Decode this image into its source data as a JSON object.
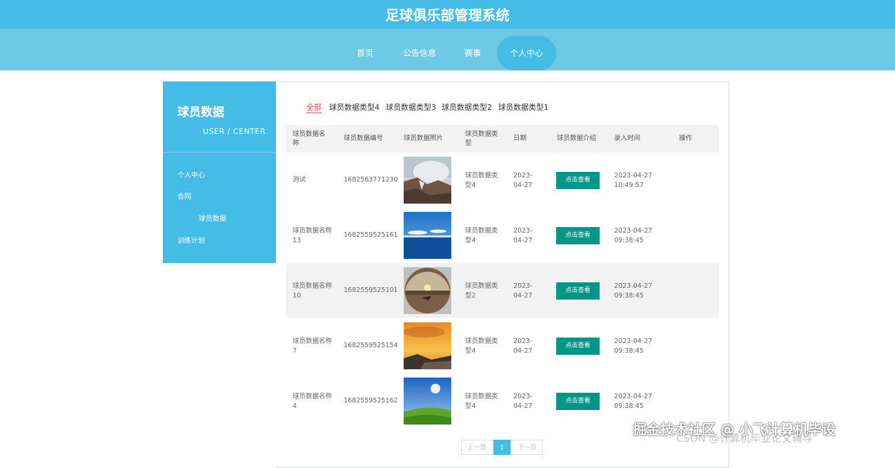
{
  "header": {
    "title": "足球俱乐部管理系统"
  },
  "nav": {
    "items": [
      {
        "label": "首页",
        "active": false
      },
      {
        "label": "公告信息",
        "active": false
      },
      {
        "label": "赛事",
        "active": false
      },
      {
        "label": "个人中心",
        "active": true
      }
    ]
  },
  "sidebar": {
    "title": "球员数据",
    "subtitle": "USER / CENTER",
    "items": [
      {
        "label": "个人中心"
      },
      {
        "label": "合同"
      },
      {
        "label": "球员数据"
      },
      {
        "label": "训练计划"
      }
    ]
  },
  "tabs": [
    {
      "label": "全部",
      "active": true
    },
    {
      "label": "球员数据类型4"
    },
    {
      "label": "球员数据类型3"
    },
    {
      "label": "球员数据类型2"
    },
    {
      "label": "球员数据类型1"
    }
  ],
  "table": {
    "headers": [
      "球员数据名称",
      "球员数据编号",
      "球员数据照片",
      "球员数据类型",
      "日期",
      "球员数据介绍",
      "录入时间",
      "操作"
    ],
    "rows": [
      {
        "name": "测试",
        "code": "1682563771230",
        "photo": "sea-rocks-photo",
        "type": "球员数据类型4",
        "date": "2023-04-27",
        "intro_button": "点击查看",
        "created": "2023-04-27 10:49:57"
      },
      {
        "name": "球员数据名称13",
        "code": "1682559525161",
        "photo": "ocean-sky-photo",
        "type": "球员数据类型4",
        "date": "2023-04-27",
        "intro_button": "点击查看",
        "created": "2023-04-27 09:38:45"
      },
      {
        "name": "球员数据名称10",
        "code": "1682559525101",
        "photo": "sunset-globe-photo",
        "type": "球员数据类型2",
        "date": "2023-04-27",
        "intro_button": "点击查看",
        "created": "2023-04-27 09:38:45"
      },
      {
        "name": "球员数据名称7",
        "code": "1682559525154",
        "photo": "golden-sunset-photo",
        "type": "球员数据类型4",
        "date": "2023-04-27",
        "intro_button": "点击查看",
        "created": "2023-04-27 09:38:45"
      },
      {
        "name": "球员数据名称4",
        "code": "1682559525162",
        "photo": "green-field-photo",
        "type": "球员数据类型4",
        "date": "2023-04-27",
        "intro_button": "点击查看",
        "created": "2023-04-27 09:38:45"
      }
    ]
  },
  "pager": {
    "prev": "上一页",
    "current": "1",
    "next": "下一页"
  },
  "watermarks": {
    "line1": "掘金技术社区 @ 小飞计算机毕设",
    "line2": "CSDN @计算机毕业论文辅导"
  },
  "colors": {
    "primary": "#45bce6",
    "nav": "#6ec9e5",
    "button": "#009688",
    "tab_active": "#e64545"
  }
}
